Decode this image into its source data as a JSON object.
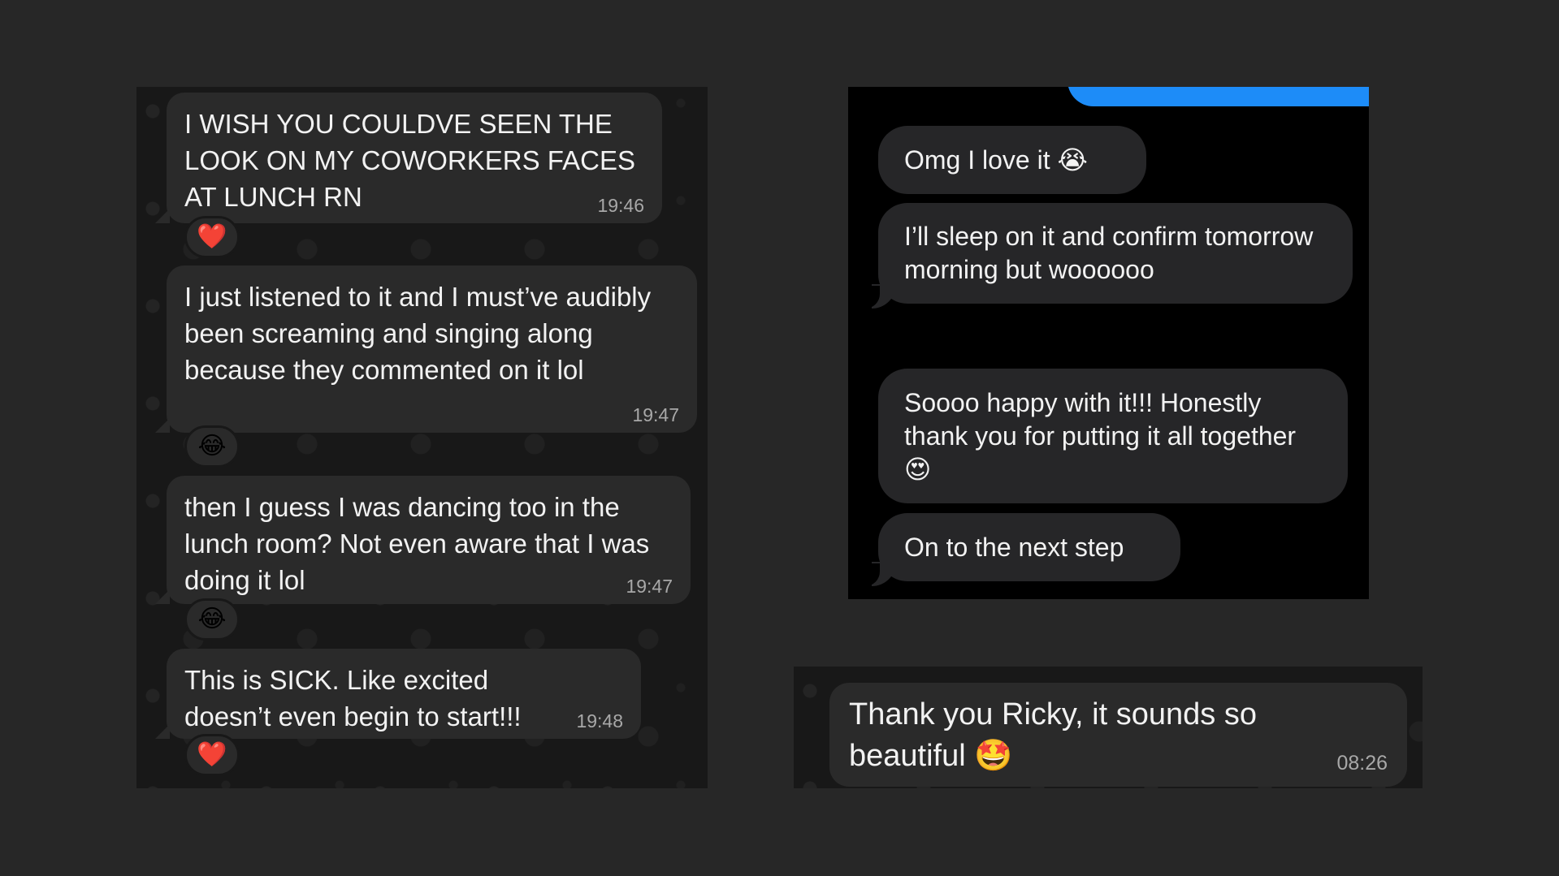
{
  "left_chat": {
    "messages": [
      {
        "text": "I WISH YOU COULDVE SEEN THE LOOK ON MY COWORKERS FACES AT LUNCH RN",
        "time": "19:46",
        "reaction": "❤️"
      },
      {
        "text": "I just listened to it and I must’ve audibly been screaming and singing along because they commented on it lol",
        "time": "19:47",
        "reaction": "😂"
      },
      {
        "text": "then I guess I was dancing too in the lunch room? Not even aware that I was doing it lol",
        "time": "19:47",
        "reaction": "😂"
      },
      {
        "text": "This is SICK. Like excited doesn’t even begin to start!!!",
        "time": "19:48",
        "reaction": "❤️"
      }
    ]
  },
  "right_chat": {
    "accent_color": "#1d8cf8",
    "messages": [
      {
        "text": "Omg I love it 😭"
      },
      {
        "text": "I’ll sleep on it and confirm tomorrow morning but woooooo"
      },
      {
        "text": "Soooo happy with it!!! Honestly thank you for putting it all together 😍"
      },
      {
        "text": "On to the next step"
      }
    ]
  },
  "bottom_chat": {
    "message": {
      "text": "Thank you Ricky, it sounds so beautiful 🤩",
      "time": "08:26"
    }
  }
}
